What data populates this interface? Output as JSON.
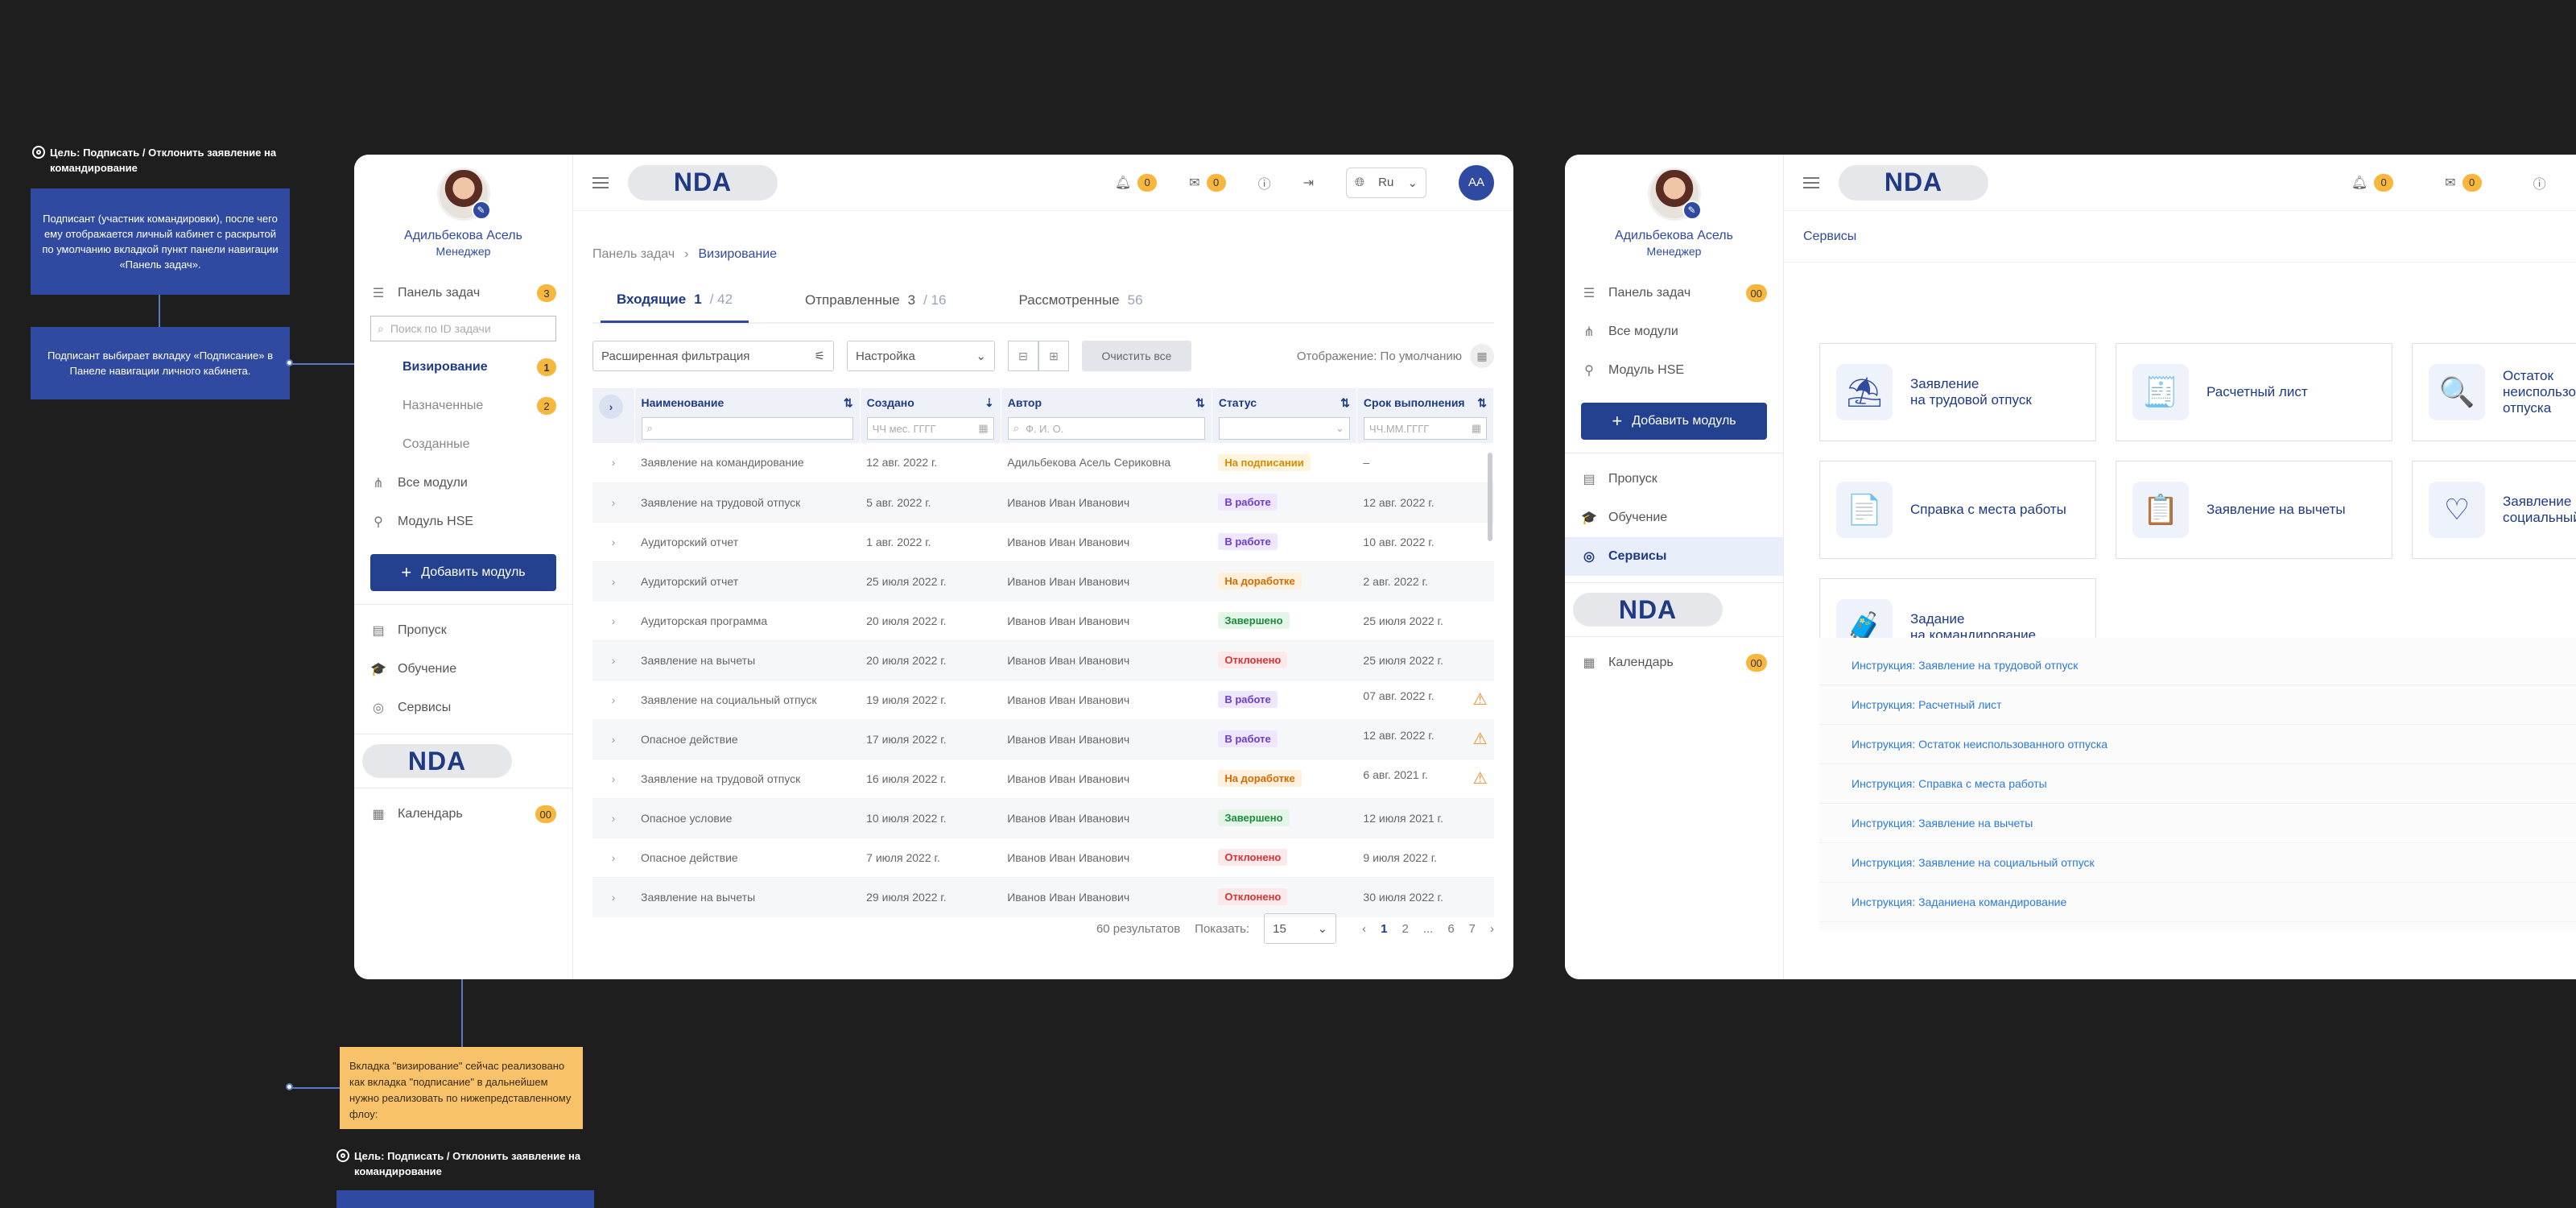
{
  "annotations": {
    "goal": "Цель: Подписать / Отклонить заявление на командирование",
    "note1": "Подписант (участник командировки), после чего ему отображается личный кабинет с раскрытой по умолчанию вкладкой пункт панели навигации «Панель задач».",
    "note2": "Подписант выбирает вкладку «Подписание» в Панеле навигации личного кабинета.",
    "note_yellow": "Вкладка \"визирование\" сейчас реализовано как вкладка \"подписание\" в дальнейшем нужно реализовать по нижепредставленному флоу:",
    "goal2": "Цель: Подписать / Отклонить заявление на командирование"
  },
  "profile": {
    "name": "Адильбекова Асель",
    "role": "Менеджер"
  },
  "brand": "NDA",
  "topbar": {
    "lang": "Ru",
    "avatar": "АА",
    "notif_count": "0",
    "msg_count": "0"
  },
  "sidebar1": {
    "tasks": "Панель задач",
    "tasks_count": "3",
    "search_placeholder": "Поиск по ID задачи",
    "sub": [
      {
        "label": "Визирование",
        "count": "1"
      },
      {
        "label": "Назначенные",
        "count": "2"
      },
      {
        "label": "Созданные",
        "count": ""
      }
    ],
    "all_modules": "Все модули",
    "hse": "Модуль HSE",
    "add_module": "Добавить модуль",
    "pass": "Пропуск",
    "training": "Обучение",
    "services": "Сервисы",
    "calendar": "Календарь",
    "calendar_count": "00"
  },
  "crumbs": {
    "root": "Панель задач",
    "current": "Визирование"
  },
  "tabs": [
    {
      "label": "Входящие",
      "count": "1",
      "total": "/ 42"
    },
    {
      "label": "Отправленные",
      "count": "3",
      "total": "/ 16"
    },
    {
      "label": "Рассмотренные",
      "count": "",
      "total": "56"
    }
  ],
  "filters": {
    "advanced": "Расширенная фильтрация",
    "setting": "Настройка",
    "clear": "Очистить все",
    "display": "Отображение: По умолчанию"
  },
  "table": {
    "headers": [
      "Наименование",
      "Создано",
      "Автор",
      "Статус",
      "Срок выполнения"
    ],
    "placeholders": {
      "created": "ЧЧ мес. ГГГГ",
      "author": "Ф. И. О.",
      "deadline": "ЧЧ.ММ.ГГГГ"
    },
    "rows": [
      {
        "name": "Заявление на командирование",
        "created": "12 авг. 2022 г.",
        "author": "Адильбекова Асель Сериковна",
        "status": "На подписании",
        "cls": "st-sign",
        "deadline": "–",
        "warn": ""
      },
      {
        "name": "Заявление на трудовой отпуск",
        "created": "5 авг. 2022 г.",
        "author": "Иванов Иван Иванович",
        "status": "В работе",
        "cls": "st-work",
        "deadline": "12 авг. 2022 г.",
        "warn": ""
      },
      {
        "name": "Аудиторский отчет",
        "created": "1 авг. 2022 г.",
        "author": "Иванов Иван Иванович",
        "status": "В работе",
        "cls": "st-work",
        "deadline": "10 авг. 2022 г.",
        "warn": ""
      },
      {
        "name": "Аудиторский отчет",
        "created": "25 июля 2022 г.",
        "author": "Иванов Иван Иванович",
        "status": "На доработке",
        "cls": "st-rev",
        "deadline": "2 авг. 2022 г.",
        "warn": ""
      },
      {
        "name": "Аудиторская программа",
        "created": "20 июля 2022 г.",
        "author": "Иванов Иван Иванович",
        "status": "Завершено",
        "cls": "st-done",
        "deadline": "25 июля 2022 г.",
        "warn": ""
      },
      {
        "name": "Заявление на вычеты",
        "created": "20 июля 2022 г.",
        "author": "Иванов Иван Иванович",
        "status": "Отклонено",
        "cls": "st-rej",
        "deadline": "25 июля 2022 г.",
        "warn": ""
      },
      {
        "name": "Заявление на социальный отпуск",
        "created": "19 июля 2022 г.",
        "author": "Иванов Иван Иванович",
        "status": "В работе",
        "cls": "st-work",
        "deadline": "07 авг. 2022 г.",
        "warn": "⚠"
      },
      {
        "name": "Опасное действие",
        "created": "17 июля 2022 г.",
        "author": "Иванов Иван Иванович",
        "status": "В работе",
        "cls": "st-work",
        "deadline": "12 авг. 2022 г.",
        "warn": "⚠"
      },
      {
        "name": "Заявление на трудовой отпуск",
        "created": "16 июля 2022 г.",
        "author": "Иванов Иван Иванович",
        "status": "На доработке",
        "cls": "st-rev",
        "deadline": "6 авг. 2021 г.",
        "warn": "⚠"
      },
      {
        "name": "Опасное условие",
        "created": "10 июля 2022 г.",
        "author": "Иванов Иван Иванович",
        "status": "Завершено",
        "cls": "st-done",
        "deadline": "12 июля 2021 г.",
        "warn": ""
      },
      {
        "name": "Опасное действие",
        "created": "7 июля 2022 г.",
        "author": "Иванов Иван Иванович",
        "status": "Отклонено",
        "cls": "st-rej",
        "deadline": "9 июля 2022 г.",
        "warn": ""
      },
      {
        "name": "Заявление на вычеты",
        "created": "29 июля 2022 г.",
        "author": "Иванов Иван Иванович",
        "status": "Отклонено",
        "cls": "st-rej",
        "deadline": "30 июля 2022 г.",
        "warn": ""
      }
    ]
  },
  "pager": {
    "results": "60 результатов",
    "show": "Показать:",
    "per_page": "15",
    "pages": [
      "1",
      "2",
      "...",
      "6",
      "7"
    ]
  },
  "sidebar2": {
    "tasks": "Панель задач",
    "tasks_count": "00",
    "all_modules": "Все модули",
    "hse": "Модуль HSE",
    "add_module": "Добавить модуль",
    "pass": "Пропуск",
    "training": "Обучение",
    "services": "Сервисы",
    "calendar": "Календарь",
    "calendar_count": "00"
  },
  "frame2": {
    "crumb": "Сервисы",
    "cards": [
      {
        "label": "Заявление\nна трудовой отпуск",
        "icon": "beach-umbrella-icon",
        "glyph": "⛱"
      },
      {
        "label": "Расчетный лист",
        "icon": "payslip-icon",
        "glyph": "🧾"
      },
      {
        "label": "Остаток неиспользованного отпуска",
        "icon": "magnifier-doc-icon",
        "glyph": "🔍"
      },
      {
        "label": "Справка с места работы",
        "icon": "certificate-icon",
        "glyph": "📄"
      },
      {
        "label": "Заявление на вычеты",
        "icon": "deduction-icon",
        "glyph": "📋"
      },
      {
        "label": "Заявление на социальный отпуск",
        "icon": "heart-hand-icon",
        "glyph": "♡"
      },
      {
        "label": "Задание\nна командирование",
        "icon": "suitcase-icon",
        "glyph": "🧳"
      }
    ],
    "instructions": [
      "Инструкция: Заявление на трудовой отпуск",
      "Инструкция: Расчетный лист",
      "Инструкция: Остаток неиспользованного отпуска",
      "Инструкция: Справка с места работы",
      "Инструкция: Заявление на вычеты",
      "Инструкция: Заявление на социальный отпуск",
      "Инструкция: Заданиена командирование"
    ]
  }
}
